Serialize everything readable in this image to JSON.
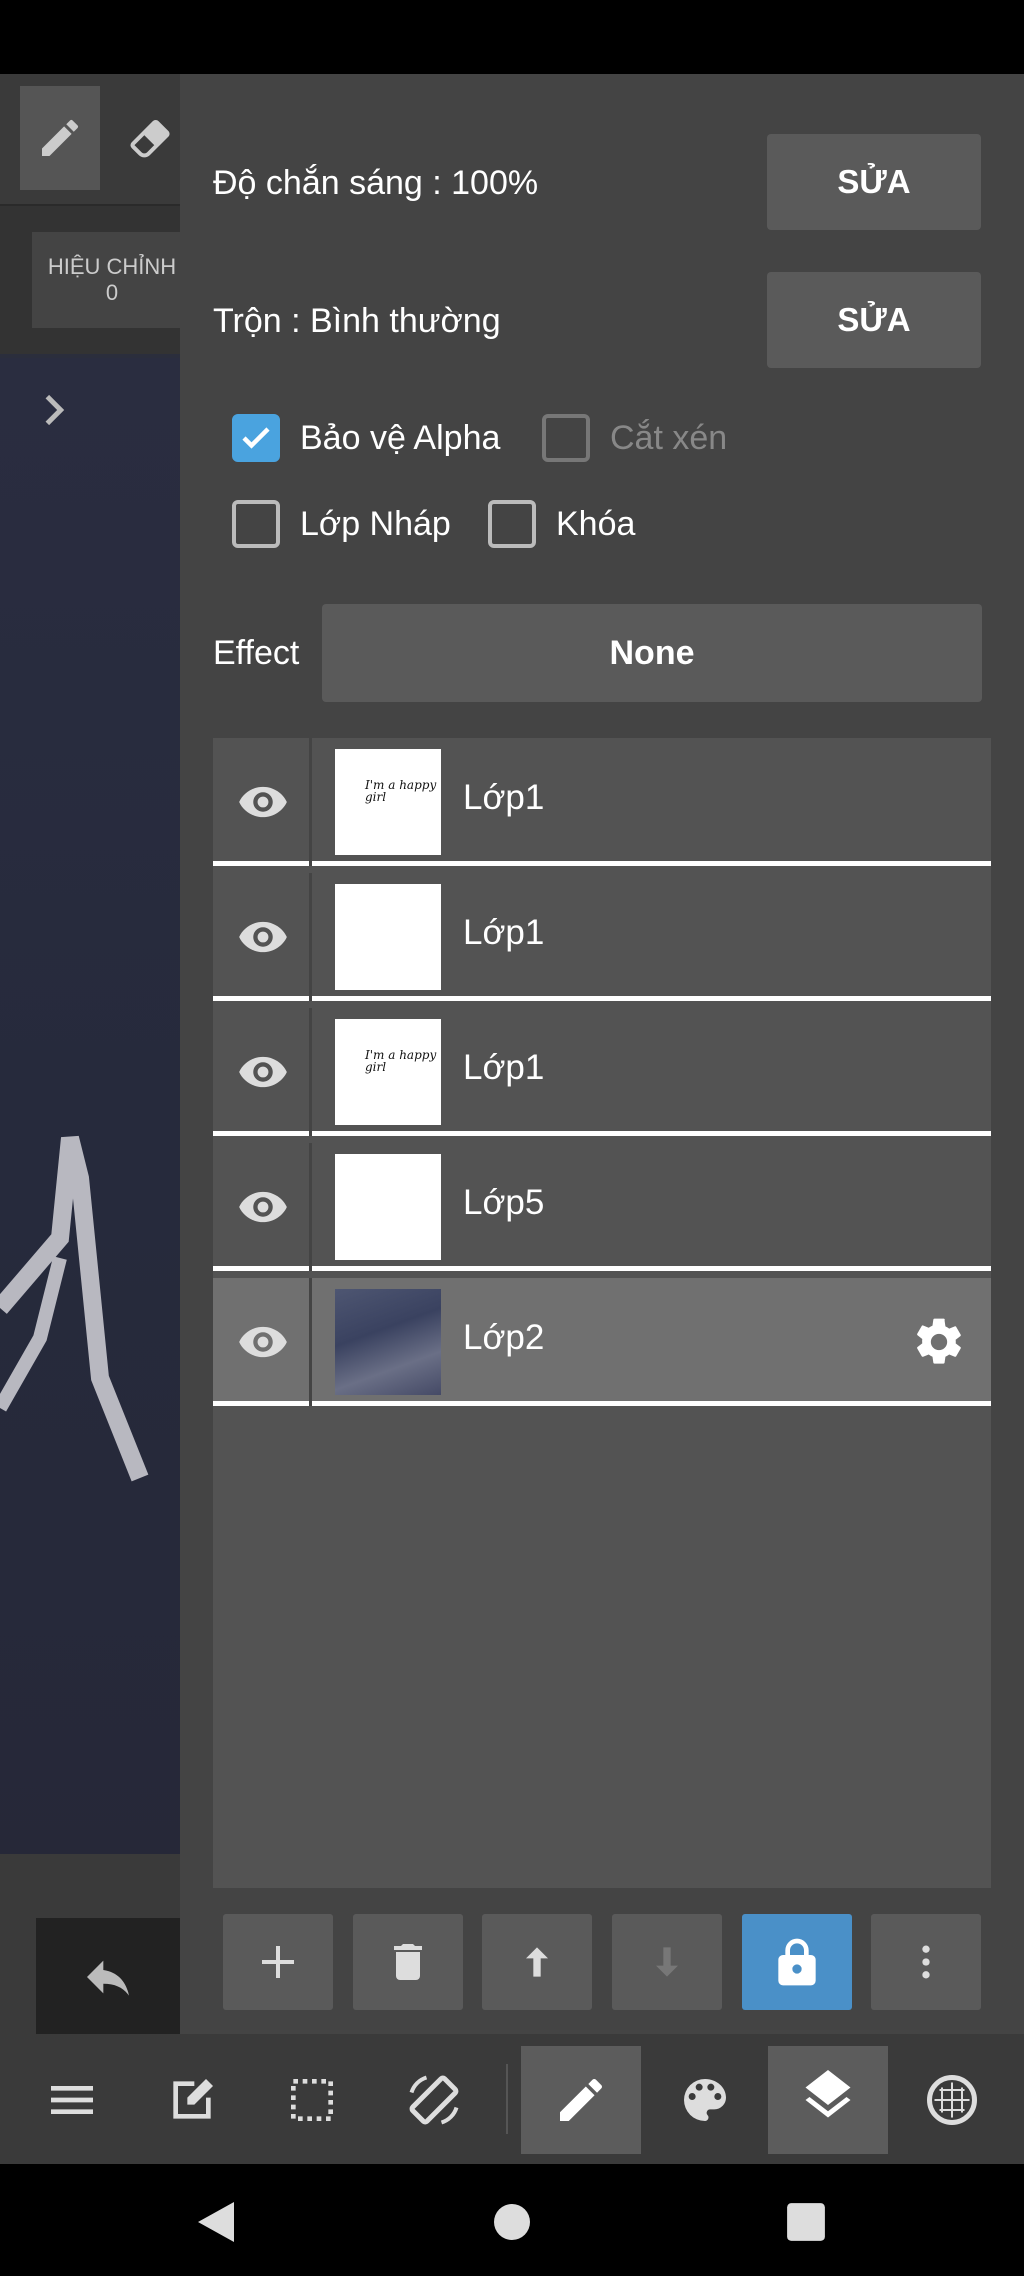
{
  "canvas": {
    "adjust_label": "HIỆU CHỈNH",
    "adjust_value": "0"
  },
  "panel": {
    "opacity_label": "Độ chắn sáng : 100%",
    "opacity_edit": "SỬA",
    "blend_label": "Trộn : Bình thường",
    "blend_edit": "SỬA",
    "checkboxes": {
      "protect_alpha": {
        "label": "Bảo vệ Alpha",
        "checked": true
      },
      "clipping": {
        "label": "Cắt xén",
        "checked": false,
        "disabled": true
      },
      "draft_layer": {
        "label": "Lớp Nháp",
        "checked": false
      },
      "lock": {
        "label": "Khóa",
        "checked": false
      }
    },
    "effect_label": "Effect",
    "effect_value": "None"
  },
  "layers": [
    {
      "name": "Lớp1",
      "thumb": "text",
      "thumb_text": "I'm a happy girl"
    },
    {
      "name": "Lớp1",
      "thumb": "blank"
    },
    {
      "name": "Lớp1",
      "thumb": "text",
      "thumb_text": "I'm a happy girl"
    },
    {
      "name": "Lớp5",
      "thumb": "blank"
    },
    {
      "name": "Lớp2",
      "thumb": "photo",
      "selected": true
    }
  ],
  "actions": [
    "add-icon",
    "trash-icon",
    "arrow-up-icon",
    "arrow-down-icon",
    "lock-icon",
    "more-vertical-icon"
  ],
  "bottom_toolbar": [
    "menu-icon",
    "edit-icon",
    "selection-icon",
    "rotate-icon",
    "brush-icon",
    "palette-icon",
    "layers-icon",
    "material-icon"
  ],
  "colors": {
    "accent": "#4a90c8",
    "checkbox_checked": "#4aa3df",
    "panel": "#444444"
  }
}
